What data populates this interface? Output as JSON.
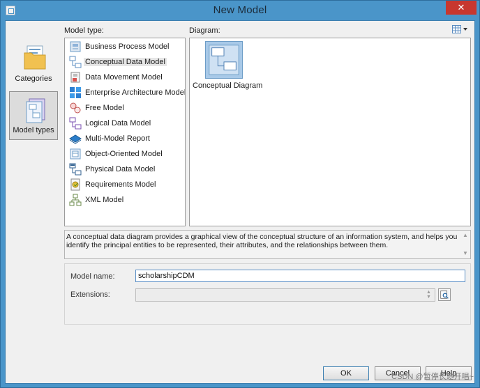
{
  "window": {
    "title": "New Model",
    "close_glyph": "✕"
  },
  "categories": [
    {
      "label": "Categories",
      "icon": "folder-icon",
      "selected": false
    },
    {
      "label": "Model types",
      "icon": "model-types-icon",
      "selected": true
    }
  ],
  "model_type": {
    "label": "Model type:",
    "items": [
      {
        "label": "Business Process Model",
        "icon": "business-process-model-icon"
      },
      {
        "label": "Conceptual Data Model",
        "icon": "conceptual-data-model-icon",
        "selected": true
      },
      {
        "label": "Data Movement Model",
        "icon": "data-movement-model-icon"
      },
      {
        "label": "Enterprise Architecture Model",
        "icon": "enterprise-architecture-model-icon"
      },
      {
        "label": "Free Model",
        "icon": "free-model-icon"
      },
      {
        "label": "Logical Data Model",
        "icon": "logical-data-model-icon"
      },
      {
        "label": "Multi-Model Report",
        "icon": "multi-model-report-icon"
      },
      {
        "label": "Object-Oriented Model",
        "icon": "object-oriented-model-icon"
      },
      {
        "label": "Physical Data Model",
        "icon": "physical-data-model-icon"
      },
      {
        "label": "Requirements Model",
        "icon": "requirements-model-icon"
      },
      {
        "label": "XML Model",
        "icon": "xml-model-icon"
      }
    ]
  },
  "diagram": {
    "label": "Diagram:",
    "items": [
      {
        "label": "Conceptual Diagram",
        "icon": "conceptual-diagram-icon"
      }
    ],
    "view_toggle_icon": "view-options-icon"
  },
  "description": "A conceptual data diagram provides a graphical view of the conceptual structure of an information system, and helps you identify the principal entities to be represented, their attributes, and the relationships between them.",
  "form": {
    "model_name_label": "Model name:",
    "model_name_value": "scholarshipCDM",
    "extensions_label": "Extensions:",
    "extensions_value": ""
  },
  "buttons": {
    "ok": "OK",
    "cancel": "Cancel",
    "help": "Help"
  },
  "watermark": "CSDN @暂停长途开唱~",
  "colors": {
    "title_bar": "#4a95c9",
    "close_button": "#c7372f",
    "selection": "#e6e6e6",
    "input_border": "#5a8fc6"
  }
}
